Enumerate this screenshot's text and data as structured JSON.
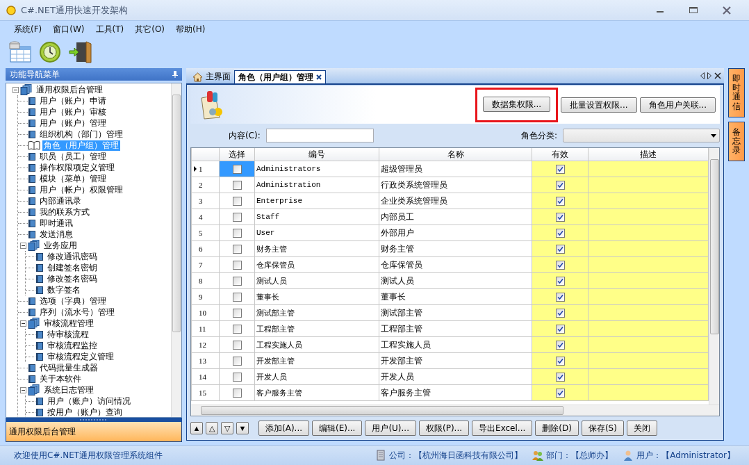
{
  "window": {
    "title": "C#.NET通用快速开发架构"
  },
  "menu": [
    "系统(F)",
    "窗口(W)",
    "工具(T)",
    "其它(O)",
    "帮助(H)"
  ],
  "nav_panel": {
    "title": "功能导航菜单",
    "footer": "通用权限后台管理",
    "tree": [
      {
        "label": "通用权限后台管理",
        "expanded": true,
        "selected": false,
        "children": [
          {
            "label": "用户（账户）申请",
            "selected": false
          },
          {
            "label": "用户（账户）审核",
            "selected": false
          },
          {
            "label": "用户（账户）管理",
            "selected": false
          },
          {
            "label": "组织机构（部门）管理",
            "selected": false
          },
          {
            "label": "角色（用户组）管理",
            "selected": true
          },
          {
            "label": "职员（员工）管理",
            "selected": false
          },
          {
            "label": "操作权限项定义管理",
            "selected": false
          },
          {
            "label": "模块（菜单）管理",
            "selected": false
          },
          {
            "label": "用户（帐户）权限管理",
            "selected": false
          },
          {
            "label": "内部通讯录",
            "selected": false
          },
          {
            "label": "我的联系方式",
            "selected": false
          },
          {
            "label": "即时通讯",
            "selected": false
          },
          {
            "label": "发送消息",
            "selected": false
          },
          {
            "label": "业务应用",
            "expanded": true,
            "selected": false,
            "children": [
              {
                "label": "修改通讯密码",
                "selected": false
              },
              {
                "label": "创建签名密钥",
                "selected": false
              },
              {
                "label": "修改签名密码",
                "selected": false
              },
              {
                "label": "数字签名",
                "selected": false
              }
            ]
          },
          {
            "label": "选项（字典）管理",
            "selected": false
          },
          {
            "label": "序列（流水号）管理",
            "selected": false
          },
          {
            "label": "审核流程管理",
            "expanded": true,
            "selected": false,
            "children": [
              {
                "label": "待审核流程",
                "selected": false
              },
              {
                "label": "审核流程监控",
                "selected": false
              },
              {
                "label": "审核流程定义管理",
                "selected": false
              }
            ]
          },
          {
            "label": "代码批量生成器",
            "selected": false
          },
          {
            "label": "关于本软件",
            "selected": false
          },
          {
            "label": "系统日志管理",
            "expanded": true,
            "selected": false,
            "children": [
              {
                "label": "用户（账户）访问情况",
                "selected": false
              },
              {
                "label": "按用户（账户）查询",
                "selected": false
              }
            ]
          }
        ]
      }
    ]
  },
  "tabs": [
    {
      "label": "主界面",
      "selected": false,
      "closable": false
    },
    {
      "label": "角色（用户组）管理",
      "selected": true,
      "closable": true
    }
  ],
  "side_tabs": [
    "即时通信",
    "备忘录"
  ],
  "actions": [
    {
      "label": "数据集权限...",
      "highlighted": true
    },
    {
      "label": "批量设置权限...",
      "highlighted": false
    },
    {
      "label": "角色用户关联...",
      "highlighted": false
    }
  ],
  "filter": {
    "content_label": "内容(C):",
    "category_label": "角色分类:"
  },
  "grid": {
    "columns": [
      "选择",
      "编号",
      "名称",
      "有效",
      "描述"
    ],
    "rows": [
      {
        "number": "1",
        "current": true,
        "checked": false,
        "code": "Administrators",
        "name": "超级管理员",
        "valid": true
      },
      {
        "number": "2",
        "current": false,
        "checked": false,
        "code": "Administration",
        "name": "行政类系统管理员",
        "valid": true
      },
      {
        "number": "3",
        "current": false,
        "checked": false,
        "code": "Enterprise",
        "name": "企业类系统管理员",
        "valid": true
      },
      {
        "number": "4",
        "current": false,
        "checked": false,
        "code": "Staff",
        "name": "内部员工",
        "valid": true
      },
      {
        "number": "5",
        "current": false,
        "checked": false,
        "code": "User",
        "name": "外部用户",
        "valid": true
      },
      {
        "number": "6",
        "current": false,
        "checked": false,
        "code": "财务主管",
        "name": "财务主管",
        "valid": true
      },
      {
        "number": "7",
        "current": false,
        "checked": false,
        "code": "仓库保管员",
        "name": "仓库保管员",
        "valid": true
      },
      {
        "number": "8",
        "current": false,
        "checked": false,
        "code": "测试人员",
        "name": "测试人员",
        "valid": true
      },
      {
        "number": "9",
        "current": false,
        "checked": false,
        "code": "董事长",
        "name": "董事长",
        "valid": true
      },
      {
        "number": "10",
        "current": false,
        "checked": false,
        "code": "测试部主管",
        "name": "测试部主管",
        "valid": true
      },
      {
        "number": "11",
        "current": false,
        "checked": false,
        "code": "工程部主管",
        "name": "工程部主管",
        "valid": true
      },
      {
        "number": "12",
        "current": false,
        "checked": false,
        "code": "工程实施人员",
        "name": "工程实施人员",
        "valid": true
      },
      {
        "number": "13",
        "current": false,
        "checked": false,
        "code": "开发部主管",
        "name": "开发部主管",
        "valid": true
      },
      {
        "number": "14",
        "current": false,
        "checked": false,
        "code": "开发人员",
        "name": "开发人员",
        "valid": true
      },
      {
        "number": "15",
        "current": false,
        "checked": false,
        "code": "客户服务主管",
        "name": "客户服务主管",
        "valid": true
      }
    ]
  },
  "move_buttons": [
    "▲",
    "△",
    "▽",
    "▼"
  ],
  "buttons": [
    "添加(A)...",
    "编辑(E)...",
    "用户(U)...",
    "权限(P)...",
    "导出Excel...",
    "删除(D)",
    "保存(S)",
    "关闭"
  ],
  "status_bar": {
    "message": "欢迎使用C#.NET通用权限管理系统组件",
    "company": "公司：【杭州海日函科技有限公司】",
    "department": "部门：【总师办】",
    "user": "用户：【Administrator】"
  }
}
